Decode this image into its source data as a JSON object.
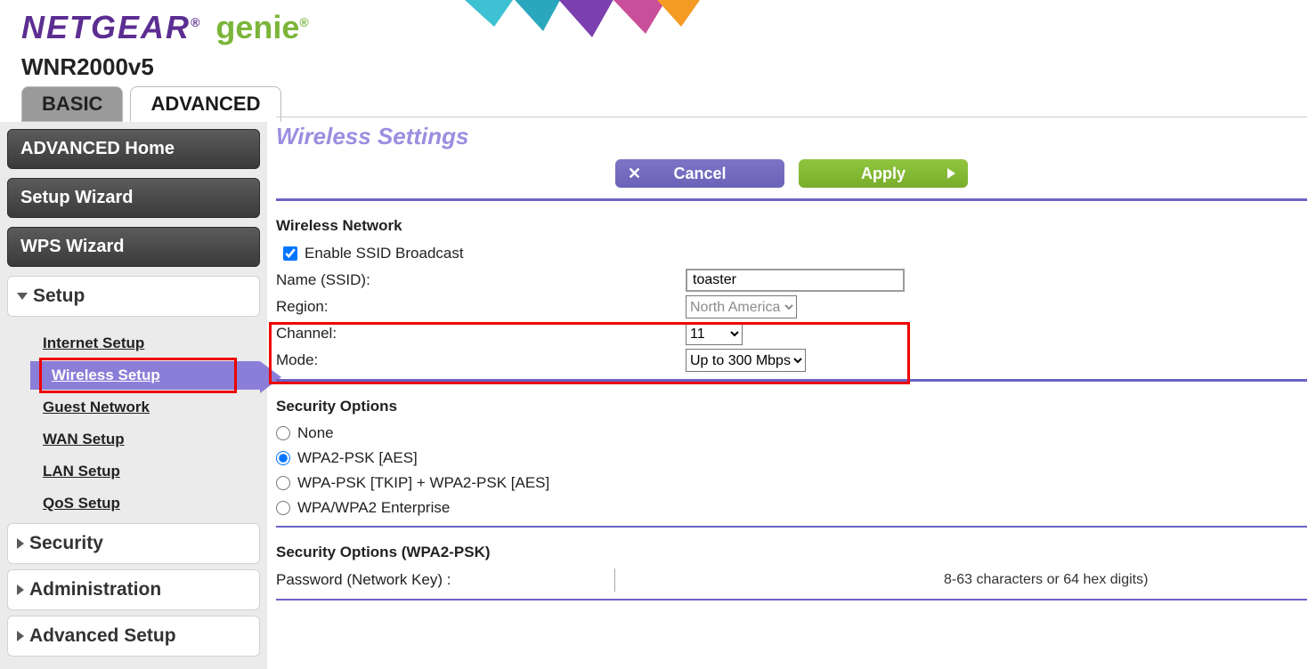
{
  "brand": {
    "name": "NETGEAR",
    "sub": "genie",
    "model": "WNR2000v5"
  },
  "tabs": {
    "basic": "BASIC",
    "advanced": "ADVANCED"
  },
  "sidebar": {
    "advanced_home": "ADVANCED Home",
    "setup_wizard": "Setup Wizard",
    "wps_wizard": "WPS Wizard",
    "setup": {
      "label": "Setup",
      "internet": "Internet Setup",
      "wireless": "Wireless Setup",
      "guest": "Guest Network",
      "wan": "WAN Setup",
      "lan": "LAN Setup",
      "qos": "QoS Setup"
    },
    "security": "Security",
    "administration": "Administration",
    "advanced_setup": "Advanced Setup"
  },
  "content": {
    "title": "Wireless Settings",
    "buttons": {
      "cancel": "Cancel",
      "apply": "Apply"
    },
    "wireless_network": {
      "heading": "Wireless Network",
      "enable_ssid_label": "Enable SSID Broadcast",
      "enable_ssid_checked": true,
      "name_label": "Name (SSID):",
      "name_value": "toaster",
      "region_label": "Region:",
      "region_value": "North America",
      "channel_label": "Channel:",
      "channel_value": "11",
      "mode_label": "Mode:",
      "mode_value": "Up to 300 Mbps"
    },
    "security_options": {
      "heading": "Security Options",
      "options": {
        "none": "None",
        "wpa2": "WPA2-PSK [AES]",
        "wpa_mix": "WPA-PSK [TKIP] + WPA2-PSK [AES]",
        "enterprise": "WPA/WPA2 Enterprise"
      },
      "selected": "wpa2"
    },
    "security_psk": {
      "heading": "Security Options (WPA2-PSK)",
      "password_label": "Password (Network Key) :",
      "password_value": "",
      "hint": "8-63 characters or 64 hex digits)"
    }
  }
}
